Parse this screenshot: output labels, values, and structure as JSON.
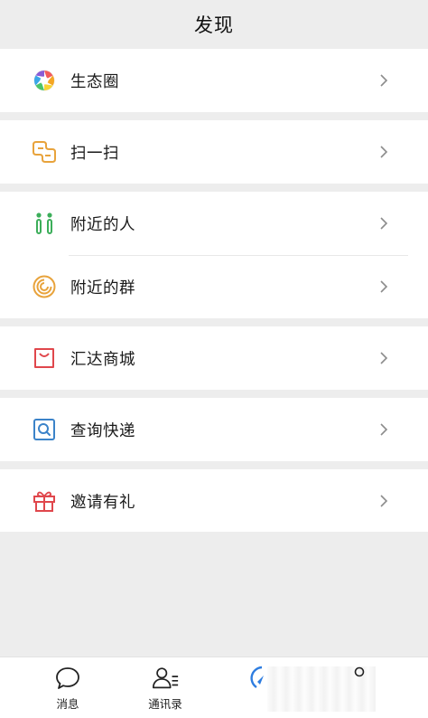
{
  "header": {
    "title": "发现"
  },
  "sections": [
    {
      "items": [
        {
          "id": "moments",
          "label": "生态圈",
          "icon": "aperture-icon"
        }
      ]
    },
    {
      "items": [
        {
          "id": "scan",
          "label": "扫一扫",
          "icon": "scan-icon"
        }
      ]
    },
    {
      "items": [
        {
          "id": "nearby-people",
          "label": "附近的人",
          "icon": "people-icon"
        },
        {
          "id": "nearby-groups",
          "label": "附近的群",
          "icon": "spiral-icon"
        }
      ]
    },
    {
      "items": [
        {
          "id": "mall",
          "label": "汇达商城",
          "icon": "shopping-bag-icon"
        }
      ]
    },
    {
      "items": [
        {
          "id": "express",
          "label": "查询快递",
          "icon": "search-box-icon"
        }
      ]
    },
    {
      "items": [
        {
          "id": "invite",
          "label": "邀请有礼",
          "icon": "gift-icon"
        }
      ]
    }
  ],
  "tabbar": {
    "tabs": [
      {
        "id": "messages",
        "label": "消息",
        "icon": "chat-bubble-icon"
      },
      {
        "id": "contacts",
        "label": "通讯录",
        "icon": "contacts-icon"
      },
      {
        "id": "discover",
        "label": "",
        "icon": "discover-icon",
        "active": true
      },
      {
        "id": "me",
        "label": "",
        "icon": "person-icon"
      }
    ]
  },
  "colors": {
    "background": "#ededed",
    "card": "#ffffff",
    "people_green": "#3cae5a",
    "scan_orange": "#e8a33c",
    "mall_red": "#e0474c",
    "express_blue": "#3b83c9",
    "gift_red": "#e0474c",
    "discover_blue": "#2e7de0"
  }
}
